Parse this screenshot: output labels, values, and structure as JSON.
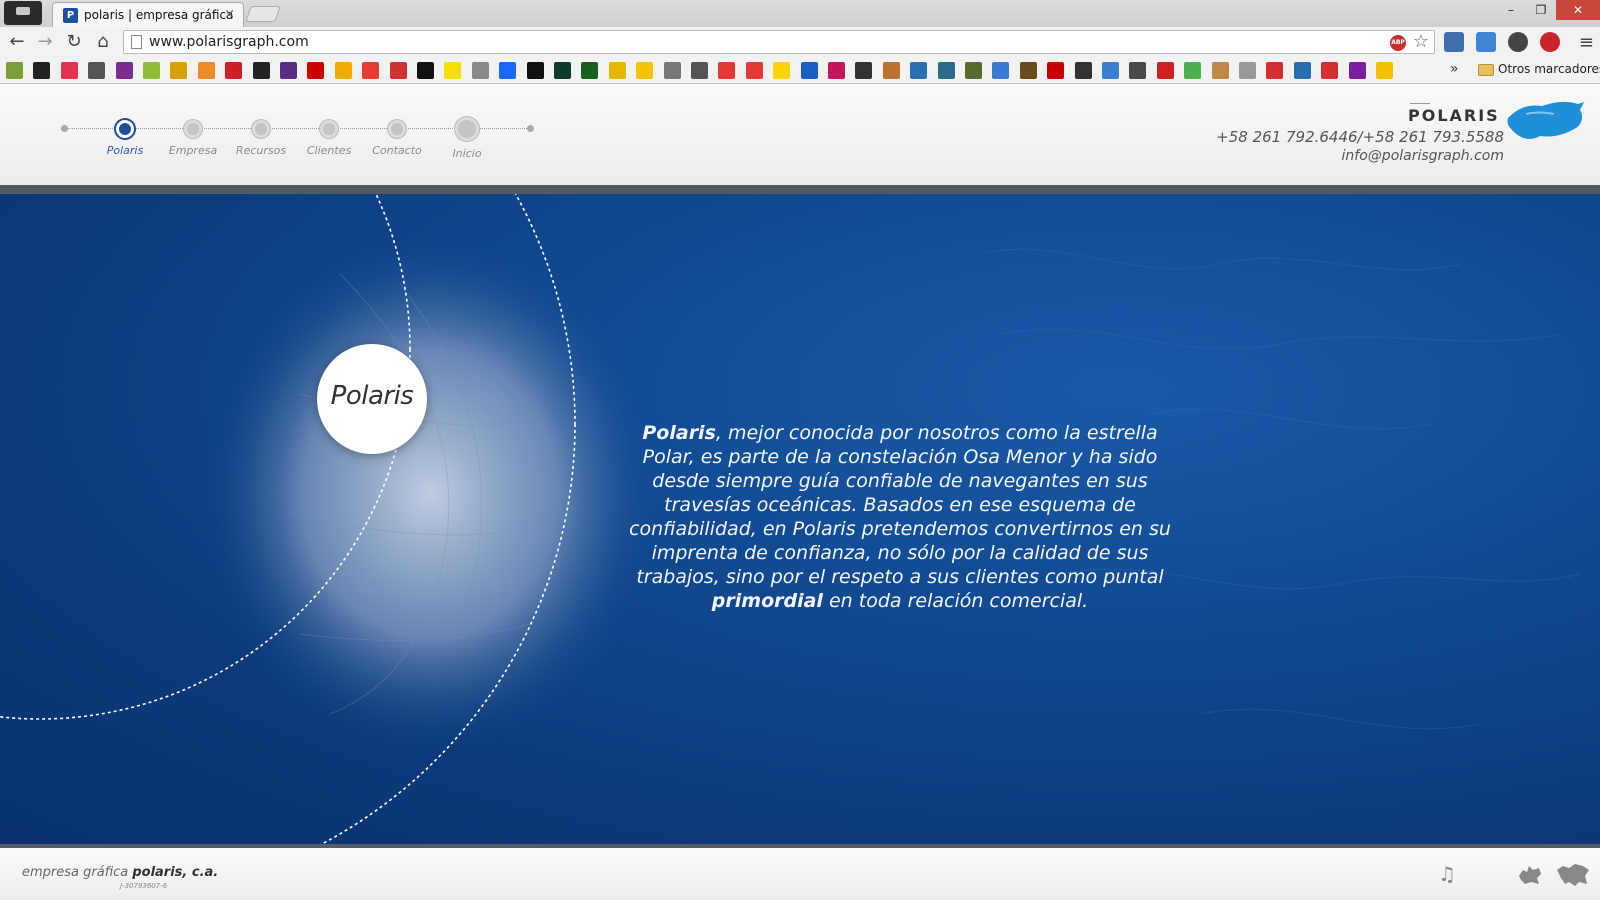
{
  "browser": {
    "tab_title": "polaris | empresa gráfica",
    "tab_favicon_letter": "P",
    "tab_close": "×",
    "url": "www.polarisgraph.com",
    "abp_label": "ABP",
    "bookmarks_overflow": "»",
    "bookmarks_folder_label": "Otros marcadores",
    "win_minimize": "–",
    "win_restore": "❐",
    "win_close": "✕",
    "nav_back": "←",
    "nav_forward": "→",
    "nav_reload": "↻",
    "nav_home": "⌂",
    "star": "☆",
    "menu": "≡"
  },
  "site": {
    "steps": [
      {
        "label": "Polaris",
        "active": true
      },
      {
        "label": "Empresa",
        "active": false
      },
      {
        "label": "Recursos",
        "active": false
      },
      {
        "label": "Clientes",
        "active": false
      },
      {
        "label": "Contacto",
        "active": false
      },
      {
        "label": "Inicio",
        "active": false
      }
    ],
    "brand": "POLARIS",
    "phone": "+58 261 792.6446/+58 261 793.5588",
    "email": "info@polarisgraph.com",
    "hero": {
      "badge": "Polaris",
      "text_bold_start": "Polaris",
      "text_part1": ", mejor conocida por nosotros como la estrella Polar, es parte de la constelación Osa Menor y ha sido desde siempre guía confiable de navegantes en sus travesías oceánicas. Basados en ese esquema de confiabilidad, en Polaris pretendemos convertirnos en su imprenta de confianza, no sólo por la calidad de sus trabajos, sino por el respeto a sus clientes como puntal ",
      "text_bold_mid": "primordial",
      "text_part2": " en toda relación comercial."
    },
    "footer": {
      "company_prefix": "empresa gráfica ",
      "company_name": "polaris, c.a.",
      "rif": "J-30793607-6",
      "icon_music": "♫",
      "icon_map": "✶"
    }
  },
  "colors": {
    "hero_blue": "#114a93",
    "active_step": "#1d4f95",
    "close_red": "#c9463d"
  },
  "icons": [
    "back-icon",
    "forward-icon",
    "reload-icon",
    "home-icon",
    "star-icon",
    "menu-icon",
    "abp-icon",
    "folder-icon"
  ]
}
